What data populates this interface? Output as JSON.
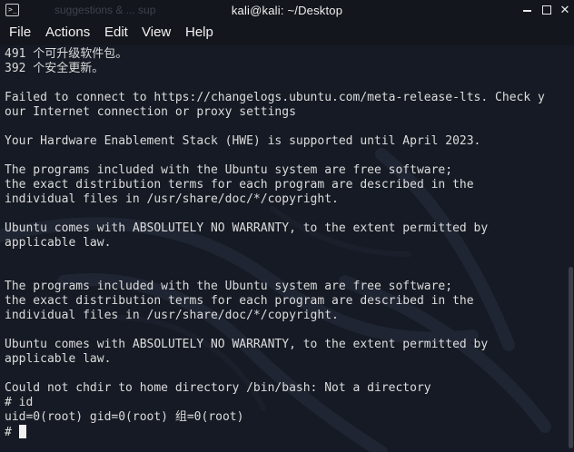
{
  "window": {
    "title": "kali@kali: ~/Desktop",
    "background_tab_text": "suggestions & ... sup",
    "controls": {
      "minimize": "minimize",
      "maximize": "maximize",
      "close": "✕"
    },
    "icon": "terminal-icon",
    "icon_glyph": ">_"
  },
  "menu": {
    "items": [
      "File",
      "Actions",
      "Edit",
      "View",
      "Help"
    ]
  },
  "terminal": {
    "lines": [
      "491 个可升级软件包。",
      "392 个安全更新。",
      "",
      "Failed to connect to https://changelogs.ubuntu.com/meta-release-lts. Check y",
      "our Internet connection or proxy settings",
      "",
      "Your Hardware Enablement Stack (HWE) is supported until April 2023.",
      "",
      "The programs included with the Ubuntu system are free software;",
      "the exact distribution terms for each program are described in the",
      "individual files in /usr/share/doc/*/copyright.",
      "",
      "Ubuntu comes with ABSOLUTELY NO WARRANTY, to the extent permitted by",
      "applicable law.",
      "",
      "",
      "The programs included with the Ubuntu system are free software;",
      "the exact distribution terms for each program are described in the",
      "individual files in /usr/share/doc/*/copyright.",
      "",
      "Ubuntu comes with ABSOLUTELY NO WARRANTY, to the extent permitted by",
      "applicable law.",
      "",
      "Could not chdir to home directory /bin/bash: Not a directory",
      "# id",
      "uid=0(root) gid=0(root) 组=0(root)"
    ],
    "prompt": "# "
  },
  "colors": {
    "terminal_bg": "#151a24",
    "text": "#dcdcdc",
    "chrome": "#14161d"
  }
}
